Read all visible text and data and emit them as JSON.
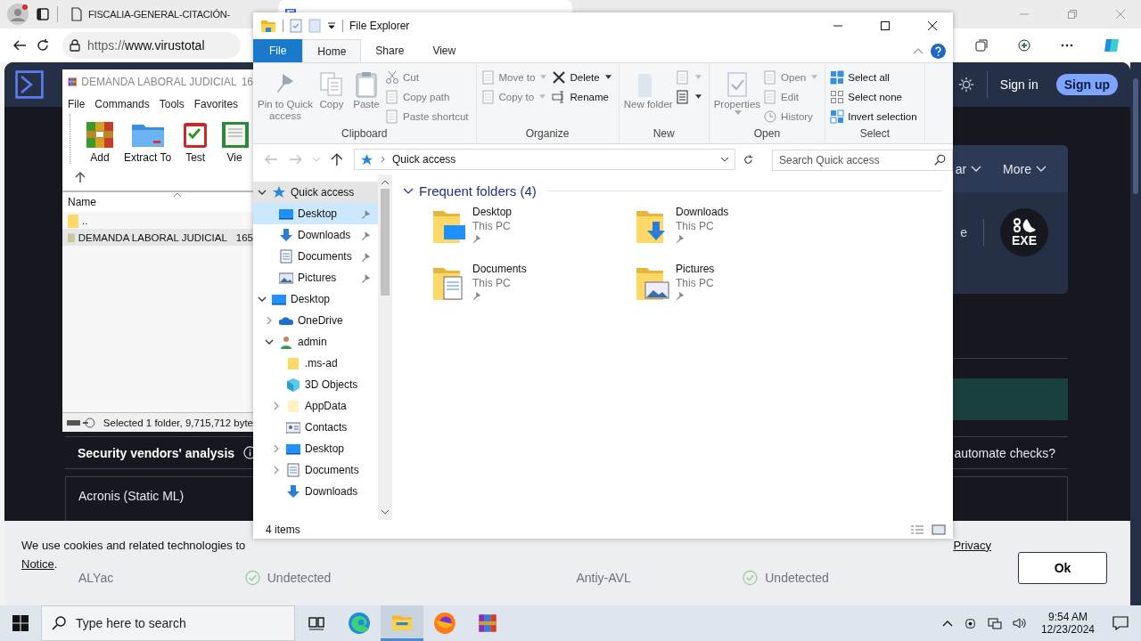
{
  "browser": {
    "tabs": [
      {
        "title": "FISCALIA-GENERAL-CITACIÓN-",
        "selected": false
      },
      {
        "selected": true
      }
    ],
    "url": {
      "scheme": "https://",
      "host": "www.virustotal"
    }
  },
  "vt": {
    "sign_in": "Sign in",
    "sign_up": "Sign up",
    "menu": [
      {
        "label": "ar"
      },
      {
        "label": "More"
      }
    ],
    "card_fragment": "e",
    "file_type": "EXE",
    "section_title": "Security vendors' analysis",
    "automate": "automate checks?",
    "first_vendor": "Acronis (Static ML)",
    "vendor_row": [
      {
        "name": "ALYac",
        "result": "Undetected"
      },
      {
        "name": "Antiy-AVL",
        "result": "Undetected"
      }
    ]
  },
  "cookie": {
    "text": "We use cookies and related technologies to",
    "link_start": "Privacy",
    "link_end": "Notice",
    "end": ".",
    "button": "Ok"
  },
  "winrar": {
    "title": "DEMANDA LABORAL JUDICIAL",
    "title_cut": "16",
    "menu": [
      "File",
      "Commands",
      "Tools",
      "Favorites"
    ],
    "tools": [
      {
        "label": "Add",
        "kind": "add"
      },
      {
        "label": "Extract To",
        "kind": "extract"
      },
      {
        "label": "Test",
        "kind": "test"
      },
      {
        "label": "Vie",
        "kind": "view"
      }
    ],
    "column": "Name",
    "rows": [
      {
        "name": "..",
        "kind": "up",
        "selected": false
      },
      {
        "name": "DEMANDA LABORAL JUDICIAL",
        "size": "165",
        "kind": "folder",
        "selected": true
      }
    ],
    "status": "Selected 1 folder, 9,715,712 byte"
  },
  "explorer": {
    "title": "File Explorer",
    "tabs": [
      {
        "label": "File",
        "kind": "file",
        "selected": false
      },
      {
        "label": "Home",
        "kind": "tab",
        "selected": true
      },
      {
        "label": "Share",
        "kind": "tab",
        "selected": false
      },
      {
        "label": "View",
        "kind": "tab",
        "selected": false
      }
    ],
    "groups": [
      {
        "label": "Clipboard",
        "columns": [
          {
            "kind": "large",
            "label": "Pin to Quick access",
            "disabled": true
          },
          {
            "kind": "large",
            "label": "Copy",
            "disabled": true
          },
          {
            "kind": "large",
            "label": "Paste",
            "disabled": true
          },
          {
            "kind": "stack",
            "items": [
              {
                "label": "Cut",
                "disabled": true
              },
              {
                "label": "Copy path",
                "disabled": true
              },
              {
                "label": "Paste shortcut",
                "disabled": true
              }
            ]
          }
        ]
      },
      {
        "label": "Organize",
        "columns": [
          {
            "kind": "stack",
            "items": [
              {
                "label": "Move to",
                "disabled": true,
                "dropdown": true
              },
              {
                "label": "Copy to",
                "disabled": true,
                "dropdown": true
              }
            ]
          },
          {
            "kind": "stack",
            "items": [
              {
                "label": "Delete",
                "disabled": false,
                "dropdown": true
              },
              {
                "label": "Rename",
                "disabled": false
              }
            ]
          }
        ]
      },
      {
        "label": "New",
        "columns": [
          {
            "kind": "large",
            "label": "New folder",
            "disabled": true
          },
          {
            "kind": "stack",
            "items": [
              {
                "disabled": true,
                "dropdown": true
              },
              {
                "disabled": false,
                "dropdown": true
              }
            ]
          }
        ]
      },
      {
        "label": "Open",
        "columns": [
          {
            "kind": "large",
            "label": "Properties",
            "disabled": true,
            "dropdown": true
          },
          {
            "kind": "stack",
            "items": [
              {
                "label": "Open",
                "disabled": true,
                "dropdown": true
              },
              {
                "label": "Edit",
                "disabled": true
              },
              {
                "label": "History",
                "disabled": true
              }
            ]
          }
        ]
      },
      {
        "label": "Select",
        "columns": [
          {
            "kind": "stack",
            "items": [
              {
                "label": "Select all",
                "disabled": false
              },
              {
                "label": "Select none",
                "disabled": false
              },
              {
                "label": "Invert selection",
                "disabled": false
              }
            ]
          }
        ]
      }
    ],
    "address": "Quick access",
    "search": {
      "placeholder": "Search Quick access"
    },
    "tree": [
      {
        "label": "Quick access",
        "kind": "star",
        "expanded": true,
        "selected": false,
        "children": [
          {
            "label": "Desktop",
            "kind": "desktop",
            "selected": true,
            "pinned": true
          },
          {
            "label": "Downloads",
            "kind": "download",
            "selected": false,
            "pinned": true
          },
          {
            "label": "Documents",
            "kind": "document",
            "selected": false,
            "pinned": true
          },
          {
            "label": "Pictures",
            "kind": "picture",
            "selected": false,
            "pinned": true
          }
        ]
      },
      {
        "label": "Desktop",
        "kind": "desktop",
        "expanded": true,
        "selected": false,
        "children": [
          {
            "label": "OneDrive",
            "kind": "cloud",
            "expanded": false,
            "selected": false
          },
          {
            "label": "admin",
            "kind": "user",
            "expanded": true,
            "selected": false,
            "children": [
              {
                "label": ".ms-ad",
                "kind": "folder",
                "selected": false
              },
              {
                "label": "3D Objects",
                "kind": "cube",
                "selected": false
              },
              {
                "label": "AppData",
                "kind": "folderlight",
                "expanded": false,
                "selected": false
              },
              {
                "label": "Contacts",
                "kind": "contacts",
                "selected": false
              },
              {
                "label": "Desktop",
                "kind": "desktop",
                "expanded": false,
                "selected": false
              },
              {
                "label": "Documents",
                "kind": "document",
                "expanded": false,
                "selected": false
              },
              {
                "label": "Downloads",
                "kind": "download",
                "selected": false
              }
            ]
          }
        ]
      }
    ],
    "section": {
      "title": "Frequent folders (4)",
      "expanded": true
    },
    "folders": [
      {
        "name": "Desktop",
        "location": "This PC",
        "kind": "desktop",
        "pinned": true
      },
      {
        "name": "Downloads",
        "location": "This PC",
        "kind": "download",
        "pinned": true
      },
      {
        "name": "Documents",
        "location": "This PC",
        "kind": "document",
        "pinned": true
      },
      {
        "name": "Pictures",
        "location": "This PC",
        "kind": "picture",
        "pinned": true
      }
    ],
    "status": "4 items"
  },
  "taskbar": {
    "search": {
      "placeholder": "Type here to search"
    },
    "apps": [
      {
        "kind": "taskview",
        "selected": false
      },
      {
        "kind": "edge",
        "selected": false
      },
      {
        "kind": "explorer",
        "selected": true
      },
      {
        "kind": "firefox",
        "selected": false
      },
      {
        "kind": "winrar",
        "selected": false
      }
    ],
    "time": "9:54 AM",
    "date": "12/23/2024"
  }
}
